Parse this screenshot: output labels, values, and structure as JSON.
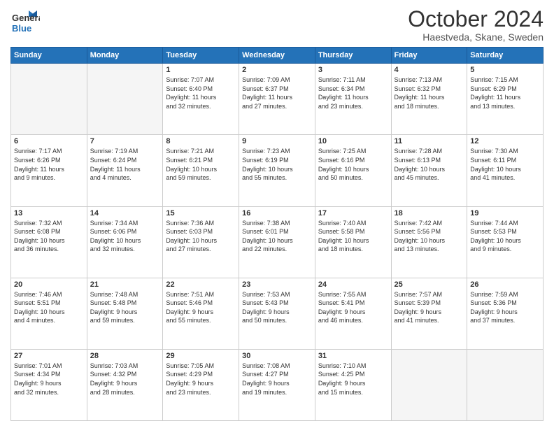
{
  "header": {
    "logo_line1": "General",
    "logo_line2": "Blue",
    "month": "October 2024",
    "location": "Haestveda, Skane, Sweden"
  },
  "weekdays": [
    "Sunday",
    "Monday",
    "Tuesday",
    "Wednesday",
    "Thursday",
    "Friday",
    "Saturday"
  ],
  "weeks": [
    [
      {
        "day": "",
        "info": ""
      },
      {
        "day": "",
        "info": ""
      },
      {
        "day": "1",
        "info": "Sunrise: 7:07 AM\nSunset: 6:40 PM\nDaylight: 11 hours\nand 32 minutes."
      },
      {
        "day": "2",
        "info": "Sunrise: 7:09 AM\nSunset: 6:37 PM\nDaylight: 11 hours\nand 27 minutes."
      },
      {
        "day": "3",
        "info": "Sunrise: 7:11 AM\nSunset: 6:34 PM\nDaylight: 11 hours\nand 23 minutes."
      },
      {
        "day": "4",
        "info": "Sunrise: 7:13 AM\nSunset: 6:32 PM\nDaylight: 11 hours\nand 18 minutes."
      },
      {
        "day": "5",
        "info": "Sunrise: 7:15 AM\nSunset: 6:29 PM\nDaylight: 11 hours\nand 13 minutes."
      }
    ],
    [
      {
        "day": "6",
        "info": "Sunrise: 7:17 AM\nSunset: 6:26 PM\nDaylight: 11 hours\nand 9 minutes."
      },
      {
        "day": "7",
        "info": "Sunrise: 7:19 AM\nSunset: 6:24 PM\nDaylight: 11 hours\nand 4 minutes."
      },
      {
        "day": "8",
        "info": "Sunrise: 7:21 AM\nSunset: 6:21 PM\nDaylight: 10 hours\nand 59 minutes."
      },
      {
        "day": "9",
        "info": "Sunrise: 7:23 AM\nSunset: 6:19 PM\nDaylight: 10 hours\nand 55 minutes."
      },
      {
        "day": "10",
        "info": "Sunrise: 7:25 AM\nSunset: 6:16 PM\nDaylight: 10 hours\nand 50 minutes."
      },
      {
        "day": "11",
        "info": "Sunrise: 7:28 AM\nSunset: 6:13 PM\nDaylight: 10 hours\nand 45 minutes."
      },
      {
        "day": "12",
        "info": "Sunrise: 7:30 AM\nSunset: 6:11 PM\nDaylight: 10 hours\nand 41 minutes."
      }
    ],
    [
      {
        "day": "13",
        "info": "Sunrise: 7:32 AM\nSunset: 6:08 PM\nDaylight: 10 hours\nand 36 minutes."
      },
      {
        "day": "14",
        "info": "Sunrise: 7:34 AM\nSunset: 6:06 PM\nDaylight: 10 hours\nand 32 minutes."
      },
      {
        "day": "15",
        "info": "Sunrise: 7:36 AM\nSunset: 6:03 PM\nDaylight: 10 hours\nand 27 minutes."
      },
      {
        "day": "16",
        "info": "Sunrise: 7:38 AM\nSunset: 6:01 PM\nDaylight: 10 hours\nand 22 minutes."
      },
      {
        "day": "17",
        "info": "Sunrise: 7:40 AM\nSunset: 5:58 PM\nDaylight: 10 hours\nand 18 minutes."
      },
      {
        "day": "18",
        "info": "Sunrise: 7:42 AM\nSunset: 5:56 PM\nDaylight: 10 hours\nand 13 minutes."
      },
      {
        "day": "19",
        "info": "Sunrise: 7:44 AM\nSunset: 5:53 PM\nDaylight: 10 hours\nand 9 minutes."
      }
    ],
    [
      {
        "day": "20",
        "info": "Sunrise: 7:46 AM\nSunset: 5:51 PM\nDaylight: 10 hours\nand 4 minutes."
      },
      {
        "day": "21",
        "info": "Sunrise: 7:48 AM\nSunset: 5:48 PM\nDaylight: 9 hours\nand 59 minutes."
      },
      {
        "day": "22",
        "info": "Sunrise: 7:51 AM\nSunset: 5:46 PM\nDaylight: 9 hours\nand 55 minutes."
      },
      {
        "day": "23",
        "info": "Sunrise: 7:53 AM\nSunset: 5:43 PM\nDaylight: 9 hours\nand 50 minutes."
      },
      {
        "day": "24",
        "info": "Sunrise: 7:55 AM\nSunset: 5:41 PM\nDaylight: 9 hours\nand 46 minutes."
      },
      {
        "day": "25",
        "info": "Sunrise: 7:57 AM\nSunset: 5:39 PM\nDaylight: 9 hours\nand 41 minutes."
      },
      {
        "day": "26",
        "info": "Sunrise: 7:59 AM\nSunset: 5:36 PM\nDaylight: 9 hours\nand 37 minutes."
      }
    ],
    [
      {
        "day": "27",
        "info": "Sunrise: 7:01 AM\nSunset: 4:34 PM\nDaylight: 9 hours\nand 32 minutes."
      },
      {
        "day": "28",
        "info": "Sunrise: 7:03 AM\nSunset: 4:32 PM\nDaylight: 9 hours\nand 28 minutes."
      },
      {
        "day": "29",
        "info": "Sunrise: 7:05 AM\nSunset: 4:29 PM\nDaylight: 9 hours\nand 23 minutes."
      },
      {
        "day": "30",
        "info": "Sunrise: 7:08 AM\nSunset: 4:27 PM\nDaylight: 9 hours\nand 19 minutes."
      },
      {
        "day": "31",
        "info": "Sunrise: 7:10 AM\nSunset: 4:25 PM\nDaylight: 9 hours\nand 15 minutes."
      },
      {
        "day": "",
        "info": ""
      },
      {
        "day": "",
        "info": ""
      }
    ]
  ]
}
